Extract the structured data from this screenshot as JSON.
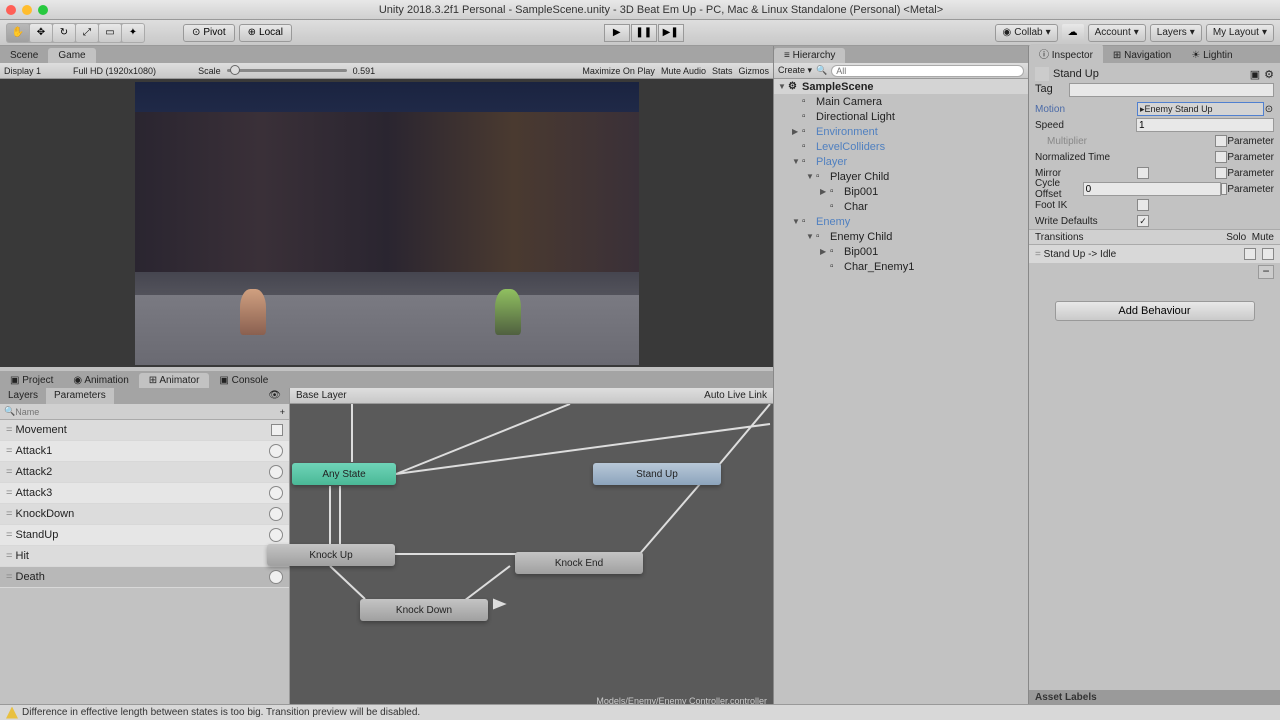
{
  "title": "Unity 2018.3.2f1 Personal - SampleScene.unity - 3D Beat Em Up - PC, Mac & Linux Standalone (Personal) <Metal>",
  "toolbar": {
    "pivot": "Pivot",
    "local": "Local",
    "collab": "Collab",
    "account": "Account",
    "layers": "Layers",
    "layout": "My Layout"
  },
  "scene_tabs": {
    "scene": "Scene",
    "game": "Game"
  },
  "scene_toolbar": {
    "display": "Display 1",
    "resolution": "Full HD (1920x1080)",
    "scale_label": "Scale",
    "scale_value": "0.591",
    "maximize": "Maximize On Play",
    "mute": "Mute Audio",
    "stats": "Stats",
    "gizmos": "Gizmos"
  },
  "bottom_tabs": {
    "project": "Project",
    "animation": "Animation",
    "animator": "Animator",
    "console": "Console"
  },
  "animator": {
    "layers_tab": "Layers",
    "params_tab": "Parameters",
    "search_placeholder": "Name",
    "base_layer": "Base Layer",
    "auto_live": "Auto Live Link",
    "path": "Models/Enemy/Enemy Controller.controller",
    "params": [
      {
        "name": "Movement",
        "type": "float"
      },
      {
        "name": "Attack1",
        "type": "trigger"
      },
      {
        "name": "Attack2",
        "type": "trigger"
      },
      {
        "name": "Attack3",
        "type": "trigger"
      },
      {
        "name": "KnockDown",
        "type": "trigger"
      },
      {
        "name": "StandUp",
        "type": "trigger"
      },
      {
        "name": "Hit",
        "type": "trigger"
      },
      {
        "name": "Death",
        "type": "trigger",
        "selected": true
      }
    ],
    "states": {
      "any": "Any State",
      "standup": "Stand Up",
      "knockup": "Knock Up",
      "knockend": "Knock End",
      "knockdown": "Knock Down"
    }
  },
  "hierarchy": {
    "title": "Hierarchy",
    "create": "Create",
    "search_ph": "All",
    "items": [
      {
        "label": "SampleScene",
        "depth": 0,
        "scene": true,
        "fold": "▼"
      },
      {
        "label": "Main Camera",
        "depth": 1
      },
      {
        "label": "Directional Light",
        "depth": 1
      },
      {
        "label": "Environment",
        "depth": 1,
        "fold": "▶",
        "prefab": true
      },
      {
        "label": "LevelColliders",
        "depth": 1,
        "prefab": true
      },
      {
        "label": "Player",
        "depth": 1,
        "fold": "▼",
        "prefab": true
      },
      {
        "label": "Player Child",
        "depth": 2,
        "fold": "▼"
      },
      {
        "label": "Bip001",
        "depth": 3,
        "fold": "▶"
      },
      {
        "label": "Char",
        "depth": 3
      },
      {
        "label": "Enemy",
        "depth": 1,
        "fold": "▼",
        "prefab": true
      },
      {
        "label": "Enemy Child",
        "depth": 2,
        "fold": "▼"
      },
      {
        "label": "Bip001",
        "depth": 3,
        "fold": "▶"
      },
      {
        "label": "Char_Enemy1",
        "depth": 3
      }
    ]
  },
  "inspector": {
    "tabs": {
      "inspector": "Inspector",
      "navigation": "Navigation",
      "lighting": "Lightin"
    },
    "name": "Stand Up",
    "tag_label": "Tag",
    "motion_label": "Motion",
    "motion_value": "Enemy Stand Up",
    "speed_label": "Speed",
    "speed_value": "1",
    "multiplier_label": "Multiplier",
    "normalized_label": "Normalized Time",
    "mirror_label": "Mirror",
    "cycle_label": "Cycle Offset",
    "cycle_value": "0",
    "footik_label": "Foot IK",
    "writedef_label": "Write Defaults",
    "parameter_label": "Parameter",
    "transitions_label": "Transitions",
    "solo": "Solo",
    "mute": "Mute",
    "transition_name": "Stand Up -> Idle",
    "add_behaviour": "Add Behaviour",
    "asset_labels": "Asset Labels"
  },
  "warning": "Difference in effective length between states is too big. Transition preview will be disabled."
}
